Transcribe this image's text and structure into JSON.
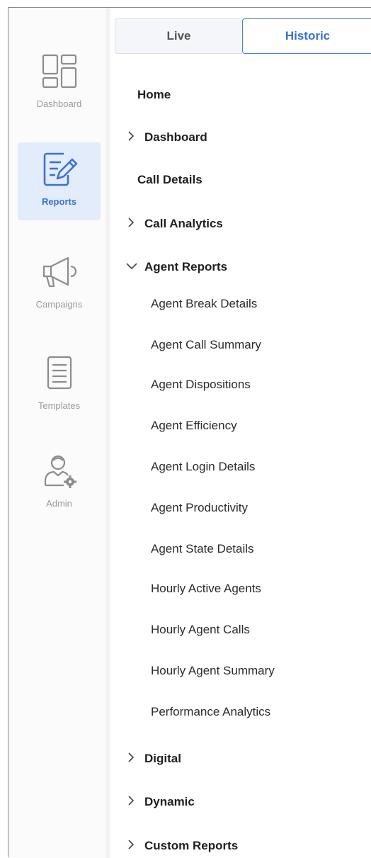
{
  "rail": {
    "items": [
      {
        "label": "Dashboard",
        "icon": "dashboard-icon"
      },
      {
        "label": "Reports",
        "icon": "reports-icon",
        "active": true
      },
      {
        "label": "Campaigns",
        "icon": "megaphone-icon"
      },
      {
        "label": "Templates",
        "icon": "document-icon"
      },
      {
        "label": "Admin",
        "icon": "admin-user-icon"
      }
    ]
  },
  "toggle": {
    "live_label": "Live",
    "historic_label": "Historic",
    "selected": "Historic"
  },
  "nav": {
    "home": "Home",
    "dashboard": "Dashboard",
    "call_details": "Call Details",
    "call_analytics": "Call Analytics",
    "agent_reports": "Agent Reports",
    "agent_items": [
      "Agent Break Details",
      "Agent Call Summary",
      "Agent Dispositions",
      "Agent Efficiency",
      "Agent Login Details",
      "Agent Productivity",
      "Agent State Details",
      "Hourly Active Agents",
      "Hourly Agent Calls",
      "Hourly Agent Summary",
      "Performance Analytics"
    ],
    "digital": "Digital",
    "dynamic": "Dynamic",
    "custom_reports": "Custom Reports"
  },
  "colors": {
    "accent": "#3b70d6",
    "active_bg": "#e3ecfa",
    "muted": "#9a9a9a"
  }
}
